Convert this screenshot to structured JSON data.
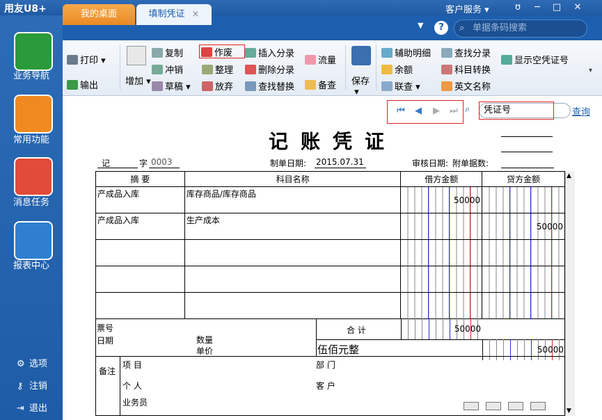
{
  "app": {
    "logo": "用友U8+",
    "service": "客户服务 ▾",
    "controls": [
      "ʊ",
      "─",
      "□",
      "✕"
    ]
  },
  "sidebar": {
    "items": [
      "业务导航",
      "常用功能",
      "消息任务",
      "报表中心"
    ],
    "bottom": [
      "选项",
      "注销",
      "退出"
    ],
    "colors": [
      "#2a9a3a",
      "#f08a20",
      "#e24a3a",
      "#2f7fd0"
    ]
  },
  "tabs": {
    "desk": "我的桌面",
    "voucher": "填制凭证",
    "close": "×"
  },
  "search": {
    "placeholder": "单据条码搜索"
  },
  "toolbar": {
    "print": "打印",
    "output": "输出",
    "add": "增加",
    "copy": "复制",
    "reverse": "冲销",
    "draft": "草稿",
    "void": "作废",
    "tidy": "整理",
    "discard": "放弃",
    "insert": "插入分录",
    "delete": "删除分录",
    "findreplace": "查找替换",
    "flow": "流量",
    "memo": "备查",
    "save": "保存",
    "aux": "辅助明细",
    "balance": "余额",
    "link": "联查",
    "findentry": "查找分录",
    "convert": "科目转换",
    "english": "英文名称",
    "shownum": "显示空凭证号"
  },
  "nav": {
    "voucher_no": "凭证号",
    "query": "查询"
  },
  "voucher": {
    "title": "记账凭证",
    "type": "记",
    "zi": "字",
    "number": "0003",
    "date_label": "制单日期:",
    "date": "2015.07.31",
    "audit_label": "审核日期:",
    "attach_label": "附单据数:",
    "headers": [
      "摘 要",
      "科目名称",
      "借方金额",
      "贷方金额"
    ],
    "rows": [
      {
        "summary": "产成品入库",
        "account": "库存商品/库存商品",
        "debit": "50000",
        "credit": ""
      },
      {
        "summary": "产成品入库",
        "account": "生产成本",
        "debit": "",
        "credit": "50000"
      },
      {
        "summary": "",
        "account": "",
        "debit": "",
        "credit": ""
      },
      {
        "summary": "",
        "account": "",
        "debit": "",
        "credit": ""
      },
      {
        "summary": "",
        "account": "",
        "debit": "",
        "credit": ""
      }
    ],
    "ticket": "票号",
    "date2": "日期",
    "qty": "数量",
    "price": "单价",
    "total_label": "合 计",
    "total_debit": "50000",
    "total_credit": "50000",
    "total_words": "伍佰元整",
    "remark": "备注",
    "project": "项 目",
    "dept": "部 门",
    "person": "个 人",
    "customer": "客 户",
    "salesman": "业务员"
  }
}
